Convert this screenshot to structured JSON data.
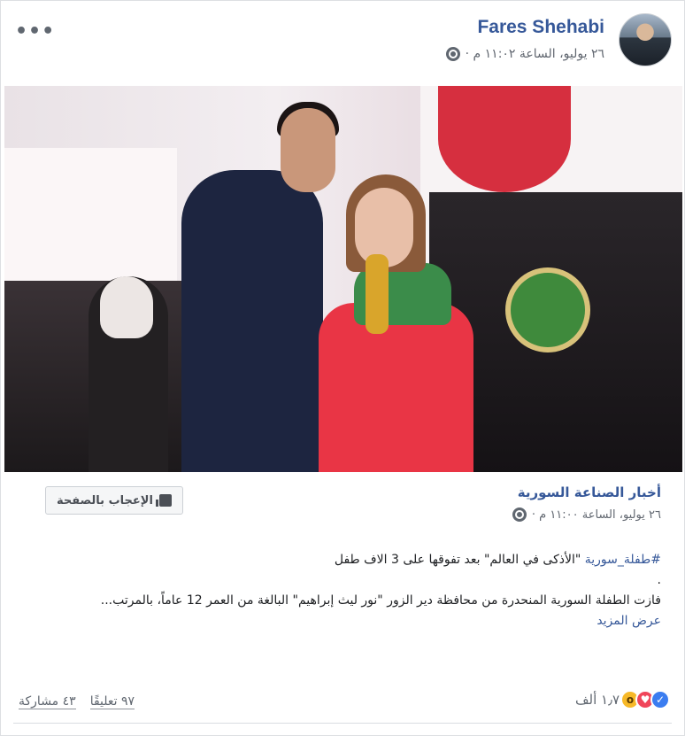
{
  "post": {
    "author": "Fares Shehabi",
    "timestamp": "٢٦ يوليو، الساعة ١١:٠٢ م ·",
    "more_label": "•••"
  },
  "shared": {
    "page_name": "أخبار الصناعة السورية",
    "timestamp": "٢٦ يوليو، الساعة ١١:٠٠ م ·",
    "like_page_label": "الإعجاب بالصفحة",
    "hashtag": "#طفلة_سورية",
    "line1_rest": " \"الأذكى في العالم\" بعد تفوقها على 3 الاف طفل",
    "line2": ".",
    "line3": "فازت الطفلة السورية المنحدرة من محافظة دير الزور \"نور ليث إبراهيم\" البالغة من العمر 12 عاماً، بالمرتب...",
    "see_more": "عرض المزيد"
  },
  "footer": {
    "reactions_count": "١٫٧ ألف",
    "comments": "٩٧ تعليقًا",
    "shares": "٤٣ مشاركة"
  },
  "icons": {
    "globe": "globe-icon",
    "like": "like-icon",
    "love": "love-icon",
    "wow": "wow-icon"
  }
}
